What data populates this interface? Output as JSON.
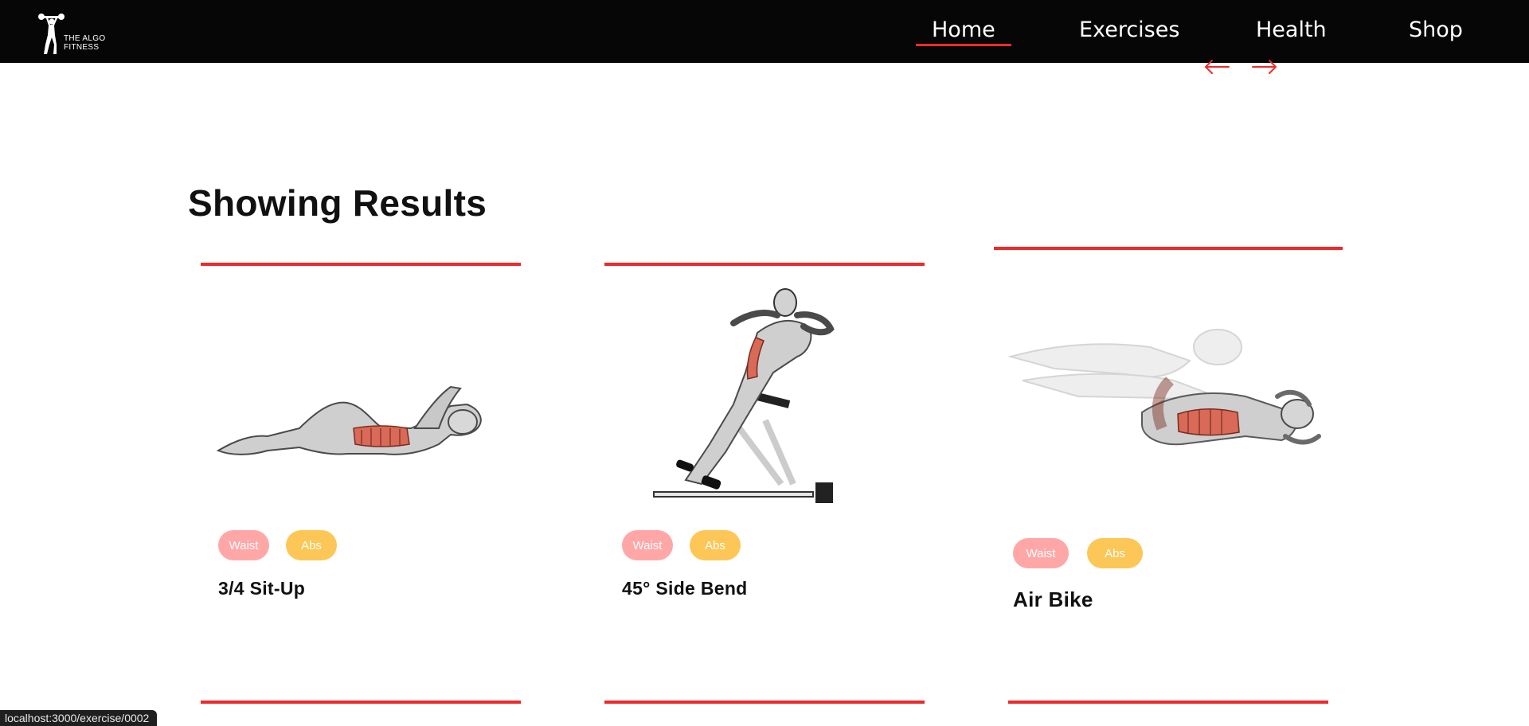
{
  "logo": {
    "line1": "THE ALGO",
    "line2": "FITNESS"
  },
  "nav": {
    "items": [
      {
        "label": "Home",
        "active": true
      },
      {
        "label": "Exercises",
        "active": false
      },
      {
        "label": "Health",
        "active": false
      },
      {
        "label": "Shop",
        "active": false
      }
    ]
  },
  "scroll": {
    "left_icon": "arrow-left-icon",
    "right_icon": "arrow-right-icon"
  },
  "heading": "Showing Results",
  "cards": [
    {
      "tags": [
        "Waist",
        "Abs"
      ],
      "title": "3/4 Sit-Up"
    },
    {
      "tags": [
        "Waist",
        "Abs"
      ],
      "title": "45° Side Bend"
    },
    {
      "tags": [
        "Waist",
        "Abs"
      ],
      "title": "Air Bike"
    }
  ],
  "colors": {
    "accent": "#ee2a2a",
    "waist_tag": "#ffa7a7",
    "abs_tag": "#fcc757",
    "navbar": "#060606"
  },
  "status_url": "localhost:3000/exercise/0002"
}
